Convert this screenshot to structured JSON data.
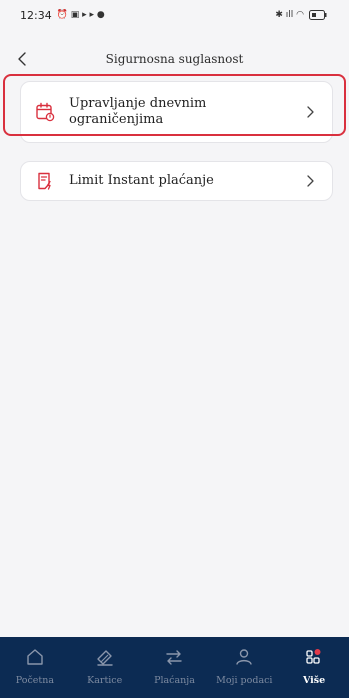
{
  "status": {
    "time": "12:34",
    "left_glyphs": "⏰ ▣ ▸ ▸ ●",
    "right_glyphs": "✱ ıll ◠"
  },
  "header": {
    "title": "Sigurnosna suglasnost"
  },
  "items": [
    {
      "label": "Upravljanje dnevnim ograničenjima",
      "icon": "calendar-limit-icon"
    },
    {
      "label": "Limit Instant plaćanje",
      "icon": "instant-payment-icon"
    }
  ],
  "nav": [
    {
      "label": "Početna",
      "icon": "home-icon"
    },
    {
      "label": "Kartice",
      "icon": "card-icon"
    },
    {
      "label": "Plaćanja",
      "icon": "transfer-icon"
    },
    {
      "label": "Moji podaci",
      "icon": "user-icon"
    },
    {
      "label": "Više",
      "icon": "more-grid-icon"
    }
  ],
  "colors": {
    "accent": "#d9303e",
    "nav_bg": "#0c2b53",
    "background": "#f5f5f7"
  }
}
